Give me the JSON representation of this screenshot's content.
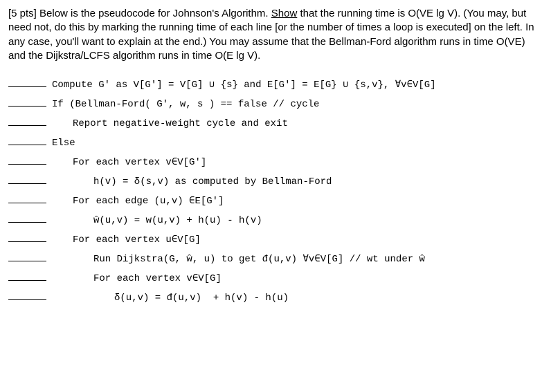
{
  "question": {
    "points_prefix": "[5 pts] ",
    "intro_a": "Below is the pseudocode for Johnson's Algorithm.  ",
    "show_word": "Show",
    "intro_b": " that the running time is O(VE lg V).  (You may, but need not, do this by marking the running time of each line [or the number of times a loop is executed] on the left.  In any case, you'll want to explain at the end.)  You may assume that the Bellman-Ford algorithm runs in time O(VE) and the Dijkstra/LCFS algorithm runs in time O(E lg V)."
  },
  "code": {
    "l1": "Compute G' as V[G'] = V[G] ∪ {s} and E[G'] = E[G} ∪ {s,v}, ∀v∈V[G]",
    "l2": "If (Bellman-Ford( G', w, s ) == false // cycle",
    "l3": "Report negative-weight cycle and exit",
    "l4": "Else",
    "l5": "For each vertex v∈V[G']",
    "l6": "h(v) = δ(s,v) as computed by Bellman-Ford",
    "l7": "For each edge (u,v) ∈E[G']",
    "l8": "ŵ(u,v) = w(u,v) + h(u) - h(v)",
    "l9": "For each vertex u∈V[G]",
    "l10": "Run Dijkstra(G, ŵ, u) to get đ(u,v) ∀v∈V[G] // wt under ŵ",
    "l11": "For each vertex v∈V[G]",
    "l12": "δ(u,v) = đ(u,v)  + h(v) - h(u)"
  }
}
